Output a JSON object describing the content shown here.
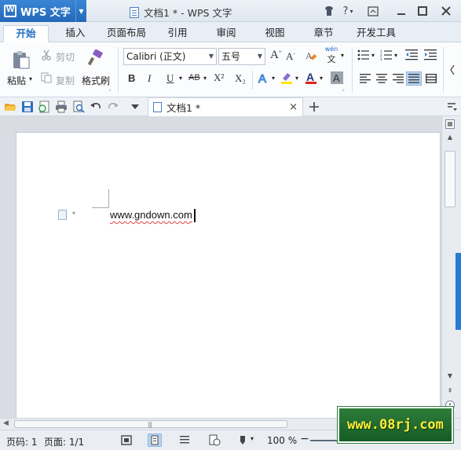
{
  "app": {
    "name": "WPS 文字",
    "window_title": "文档1 * - WPS 文字"
  },
  "ribbon_tabs": [
    "开始",
    "插入",
    "页面布局",
    "引用",
    "审阅",
    "视图",
    "章节",
    "开发工具"
  ],
  "active_tab": "开始",
  "clipboard": {
    "paste": "粘贴",
    "cut": "剪切",
    "copy": "复制",
    "format_painter": "格式刷"
  },
  "font": {
    "name": "Calibri (正文)",
    "size": "五号",
    "bold": "B",
    "italic": "I",
    "underline": "U",
    "strikethrough": "AB",
    "superscript": "X²",
    "subscript": "X₂",
    "grow": "A",
    "shrink": "A",
    "phonetic": "wén"
  },
  "document_tab": {
    "label": "文档1 *"
  },
  "document": {
    "text": "www.gndown.com"
  },
  "status": {
    "page": "页码: 1",
    "pages": "页面: 1/1",
    "zoom": "100 %"
  },
  "watermark": {
    "text": "www.08rj.com"
  },
  "colors": {
    "accent": "#2468b8",
    "tab_active_text": "#1f6fc2",
    "highlight": "#ffe600",
    "font_color": "#e02020",
    "spell_underline": "#e04040",
    "watermark_bg": "#2e7d3a",
    "watermark_text": "#ffee3a"
  }
}
